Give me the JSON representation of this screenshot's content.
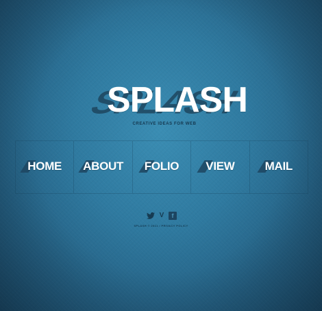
{
  "logo": {
    "text": "SPLASH",
    "tagline": "CREATIVE IDEAS FOR WEB"
  },
  "nav": {
    "items": [
      {
        "label": "HOME"
      },
      {
        "label": "ABOUT"
      },
      {
        "label": "FOLIO"
      },
      {
        "label": "VIEW"
      },
      {
        "label": "MAIL"
      }
    ]
  },
  "social": {
    "icons": [
      "twitter-icon",
      "vimeo-icon",
      "facebook-icon"
    ],
    "twitter_glyph": "🐦",
    "vimeo_glyph": "V",
    "facebook_glyph": "f"
  },
  "footer": {
    "copyright": "SPLASH © 2011 •",
    "privacy_link": "PRIVACY POLICY"
  },
  "colors": {
    "background": "#2f7aa0",
    "text_primary": "#ffffff",
    "text_dark": "#163b52",
    "shadow": "#1d4560"
  }
}
